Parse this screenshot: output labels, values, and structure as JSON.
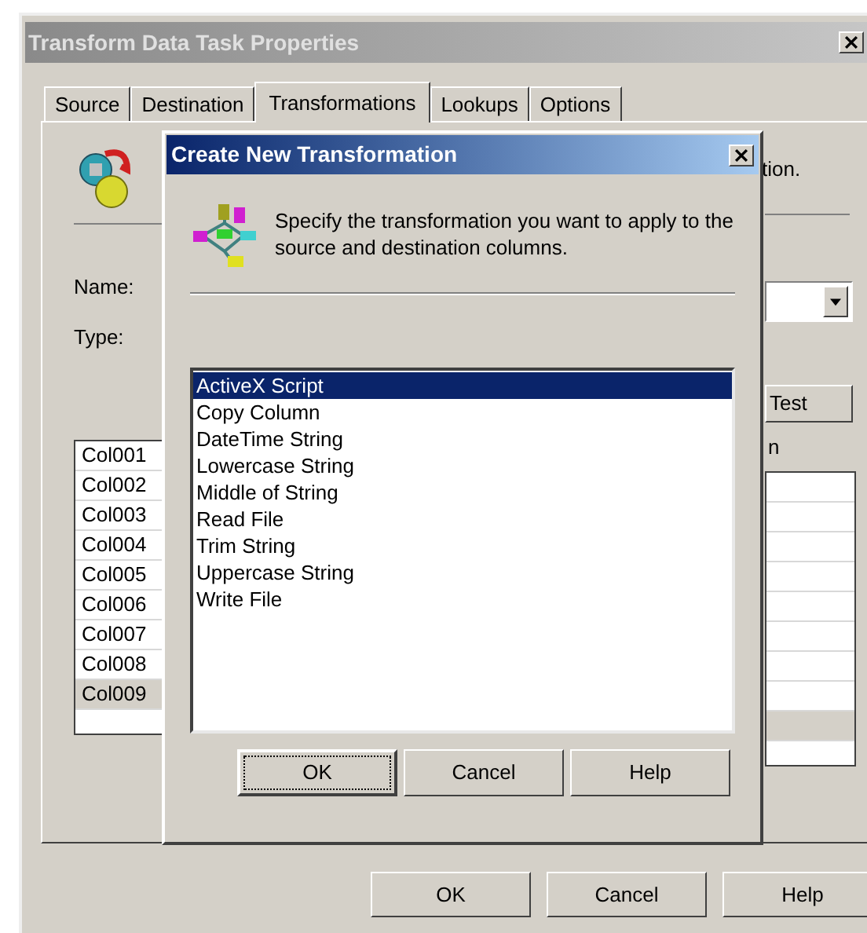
{
  "window": {
    "title": "Transform Data Task Properties"
  },
  "tabs": [
    {
      "label": "Source",
      "selected": false
    },
    {
      "label": "Destination",
      "selected": false
    },
    {
      "label": "Transformations",
      "selected": true
    },
    {
      "label": "Lookups",
      "selected": false
    },
    {
      "label": "Options",
      "selected": false
    }
  ],
  "panel": {
    "description_fragment": "tion.",
    "name_label": "Name:",
    "type_label": "Type:",
    "test_button": "Test",
    "column_header_fragment": "n",
    "source_columns": [
      {
        "label": "Col001",
        "selected": false
      },
      {
        "label": "Col002",
        "selected": false
      },
      {
        "label": "Col003",
        "selected": false
      },
      {
        "label": "Col004",
        "selected": false
      },
      {
        "label": "Col005",
        "selected": false
      },
      {
        "label": "Col006",
        "selected": false
      },
      {
        "label": "Col007",
        "selected": false
      },
      {
        "label": "Col008",
        "selected": false
      },
      {
        "label": "Col009",
        "selected": true
      }
    ]
  },
  "dialog": {
    "title": "Create New Transformation",
    "instruction": "Specify the transformation you want to apply to the source and destination columns.",
    "transformations": [
      {
        "label": "ActiveX Script",
        "selected": true
      },
      {
        "label": "Copy Column",
        "selected": false
      },
      {
        "label": "DateTime String",
        "selected": false
      },
      {
        "label": "Lowercase String",
        "selected": false
      },
      {
        "label": "Middle of String",
        "selected": false
      },
      {
        "label": "Read File",
        "selected": false
      },
      {
        "label": "Trim String",
        "selected": false
      },
      {
        "label": "Uppercase String",
        "selected": false
      },
      {
        "label": "Write File",
        "selected": false
      }
    ],
    "buttons": [
      "OK",
      "Cancel",
      "Help"
    ]
  },
  "buttons": [
    "OK",
    "Cancel",
    "Help"
  ]
}
